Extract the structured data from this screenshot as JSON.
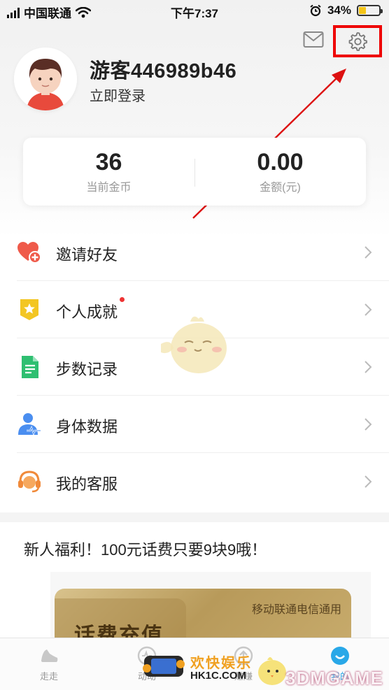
{
  "status_bar": {
    "carrier": "中国联通",
    "time": "下午7:37",
    "battery": "34%",
    "battery_level": 0.34
  },
  "profile": {
    "username": "游客446989b46",
    "login_link": "立即登录"
  },
  "stats": {
    "coins_value": "36",
    "coins_label": "当前金币",
    "amount_value": "0.00",
    "amount_label": "金额(元)"
  },
  "menu": {
    "items": [
      {
        "label": "邀请好友",
        "icon": "heart-plus-icon"
      },
      {
        "label": "个人成就",
        "icon": "star-badge-icon"
      },
      {
        "label": "步数记录",
        "icon": "document-icon"
      },
      {
        "label": "身体数据",
        "icon": "person-pulse-icon"
      },
      {
        "label": "我的客服",
        "icon": "headset-icon"
      }
    ]
  },
  "promo": {
    "title": "新人福利！100元话费只要9块9哦！",
    "card_carrier": "移动联通电信通用",
    "card_title": "话费充值"
  },
  "tabs": [
    {
      "label": "走走",
      "icon": "shoe-icon"
    },
    {
      "label": "动动",
      "icon": "activity-icon"
    },
    {
      "label": "赚赚",
      "icon": "up-arrow-icon"
    },
    {
      "label": "我的",
      "icon": "profile-icon"
    }
  ],
  "watermark": {
    "line1": "欢快娱乐",
    "line2": "HK1C.COM",
    "brand": "3DMGAME"
  },
  "colors": {
    "highlight_box": "#ee0000",
    "arrow": "#dd1111",
    "active_tab": "#29a8e8"
  }
}
